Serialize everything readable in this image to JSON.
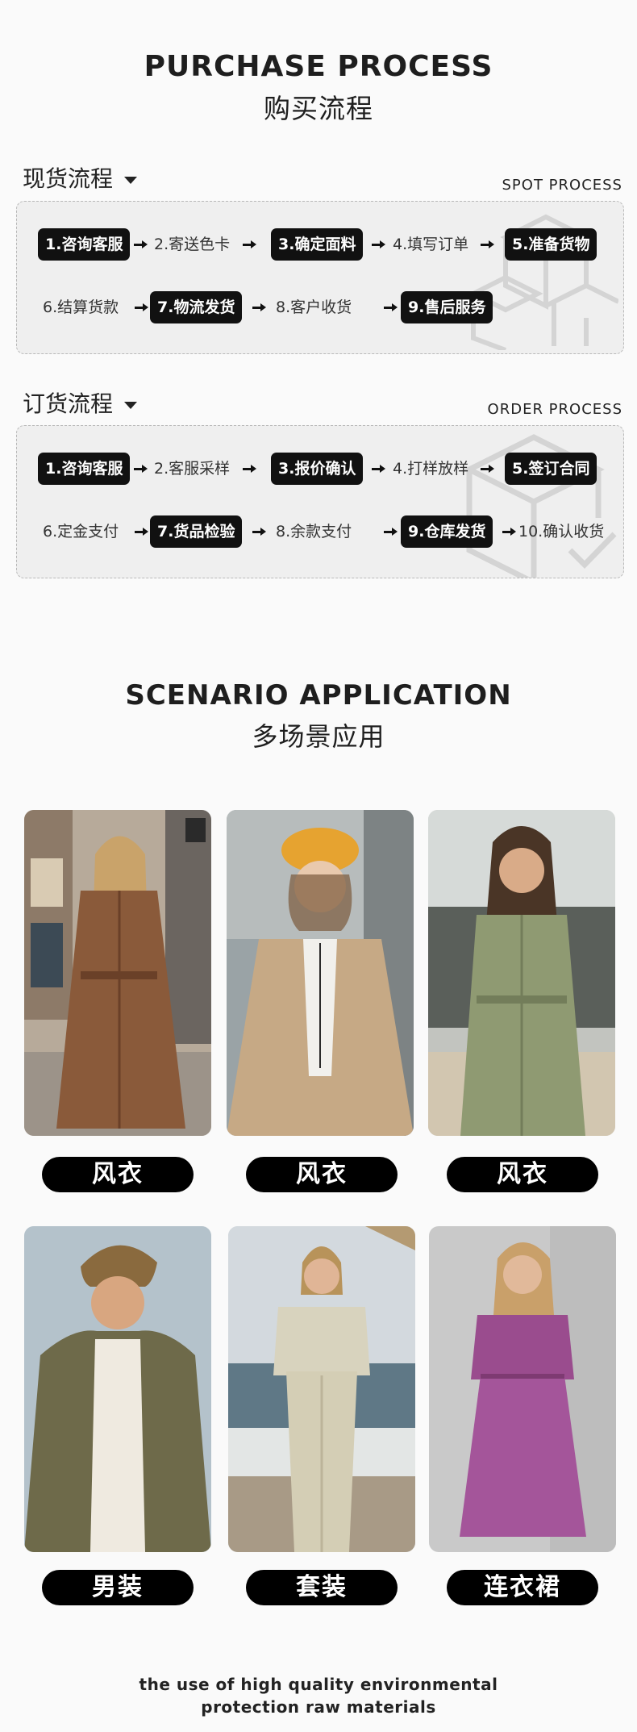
{
  "purchase": {
    "title_en": "PURCHASE PROCESS",
    "title_cn": "购买流程"
  },
  "spot": {
    "title": "现货流程",
    "title_en": "SPOT PROCESS",
    "steps": [
      "1.咨询客服",
      "2.寄送色卡",
      "3.确定面料",
      "4.填写订单",
      "5.准备货物",
      "6.结算货款",
      "7.物流发货",
      "8.客户收货",
      "9.售后服务"
    ]
  },
  "order": {
    "title": "订货流程",
    "title_en": "ORDER PROCESS",
    "steps": [
      "1.咨询客服",
      "2.客服采样",
      "3.报价确认",
      "4.打样放样",
      "5.签订合同",
      "6.定金支付",
      "7.货品检验",
      "8.余款支付",
      "9.仓库发货",
      "10.确认收货"
    ]
  },
  "scenario": {
    "title_en": "SCENARIO APPLICATION",
    "title_cn": "多场景应用",
    "items": [
      {
        "label": "风衣"
      },
      {
        "label": "风衣"
      },
      {
        "label": "风衣"
      },
      {
        "label": "男装"
      },
      {
        "label": "套装"
      },
      {
        "label": "连衣裙"
      }
    ]
  },
  "footer": {
    "line1": "the use of high quality environmental",
    "line2": "protection raw materials"
  },
  "colors": {
    "background": "#fafafa",
    "pill": "#000000",
    "box": "#efefef"
  }
}
